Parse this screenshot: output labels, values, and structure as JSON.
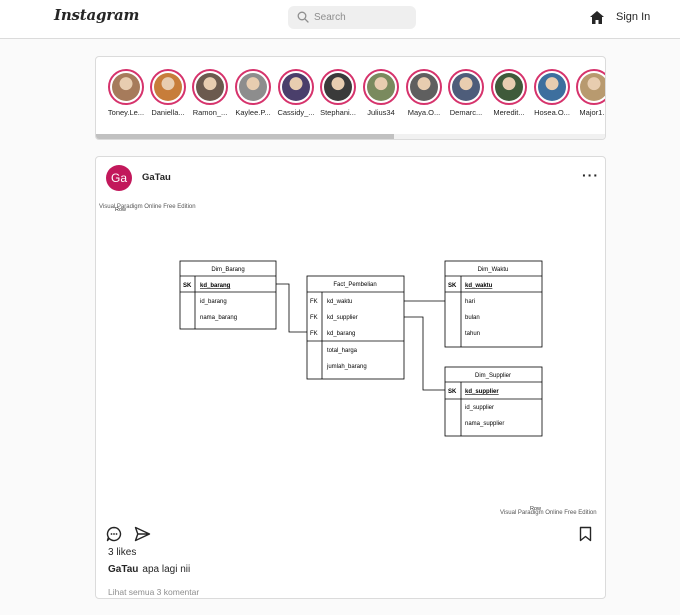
{
  "header": {
    "logo": "Instagram",
    "search_placeholder": "Search",
    "signin_label": "Sign In"
  },
  "stories": [
    {
      "username": "Toney.Le...",
      "color": "#a67b5b"
    },
    {
      "username": "Daniella...",
      "color": "#c77d3a"
    },
    {
      "username": "Ramon_...",
      "color": "#6b5a4e"
    },
    {
      "username": "Kaylee.P...",
      "color": "#8d8d8d"
    },
    {
      "username": "Cassidy_...",
      "color": "#4a3f6b"
    },
    {
      "username": "Stephani...",
      "color": "#3a3a3a"
    },
    {
      "username": "Julius34",
      "color": "#7a8a5e"
    },
    {
      "username": "Maya.O...",
      "color": "#5f5f5f"
    },
    {
      "username": "Demarc...",
      "color": "#4e5d7a"
    },
    {
      "username": "Meredit...",
      "color": "#3f5a3a"
    },
    {
      "username": "Hosea.O...",
      "color": "#3d6f9e"
    },
    {
      "username": "Major1...",
      "color": "#b89a6f"
    }
  ],
  "post": {
    "avatar_text": "Ga",
    "username": "GaTau",
    "likes": "3 likes",
    "caption_user": "GaTau",
    "caption_text": "apa lagi nii",
    "comments_link": "Lihat semua 3 komentar"
  },
  "diagram": {
    "watermark_top": "Visual Paradigm Online Free Edition",
    "watermark_top_sub": "Row",
    "watermark_bottom": "Visual Paradigm Online Free Edition",
    "watermark_bottom_sub": "Row",
    "tables": {
      "dim_barang": {
        "name": "Dim_Barang",
        "key_type": "SK",
        "key": "kd_barang",
        "attrs": [
          "id_barang",
          "nama_barang"
        ]
      },
      "fact": {
        "name": "Fact_Pembelian",
        "key_types": [
          "FK",
          "FK",
          "FK"
        ],
        "keys": [
          "kd_waktu",
          "kd_supplier",
          "kd_barang"
        ],
        "attrs": [
          "total_harga",
          "jumlah_barang"
        ]
      },
      "dim_waktu": {
        "name": "Dim_Waktu",
        "key_type": "SK",
        "key": "kd_waktu",
        "attrs": [
          "hari",
          "bulan",
          "tahun"
        ]
      },
      "dim_supplier": {
        "name": "Dim_Supplier",
        "key_type": "SK",
        "key": "kd_supplier",
        "attrs": [
          "id_supplier",
          "nama_supplier"
        ]
      }
    }
  }
}
